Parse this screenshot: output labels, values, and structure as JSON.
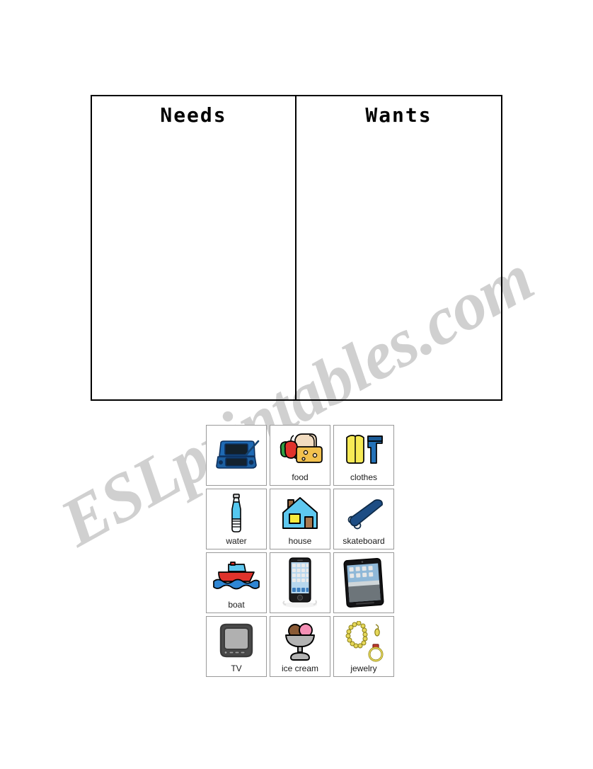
{
  "worksheet": {
    "watermark": "ESLprintables.com",
    "sorting_table": {
      "columns": [
        {
          "header": "Needs",
          "name": "needs"
        },
        {
          "header": "Wants",
          "name": "wants"
        }
      ]
    },
    "card_grid": {
      "rows": 4,
      "columns": 3,
      "cards": [
        {
          "label": "",
          "icon": "game-console-icon"
        },
        {
          "label": "food",
          "icon": "food-icon"
        },
        {
          "label": "clothes",
          "icon": "clothes-icon"
        },
        {
          "label": "water",
          "icon": "water-bottle-icon"
        },
        {
          "label": "house",
          "icon": "house-icon"
        },
        {
          "label": "skateboard",
          "icon": "skateboard-icon"
        },
        {
          "label": "boat",
          "icon": "boat-icon"
        },
        {
          "label": "",
          "icon": "smartphone-icon"
        },
        {
          "label": "",
          "icon": "tablet-icon"
        },
        {
          "label": "TV",
          "icon": "tv-icon"
        },
        {
          "label": "ice cream",
          "icon": "ice-cream-icon"
        },
        {
          "label": "jewelry",
          "icon": "jewelry-icon"
        }
      ]
    },
    "colors": {
      "ink": "#000000",
      "card_border": "#9a9a9a",
      "watermark": "#c8c8c8",
      "blue": "#1f5fa8",
      "light_blue": "#5ec8f0",
      "red": "#e8322e",
      "yellow": "#f7ea3d",
      "brown": "#8a6239",
      "gold": "#e3d24a",
      "gray": "#a8a8a8"
    }
  }
}
